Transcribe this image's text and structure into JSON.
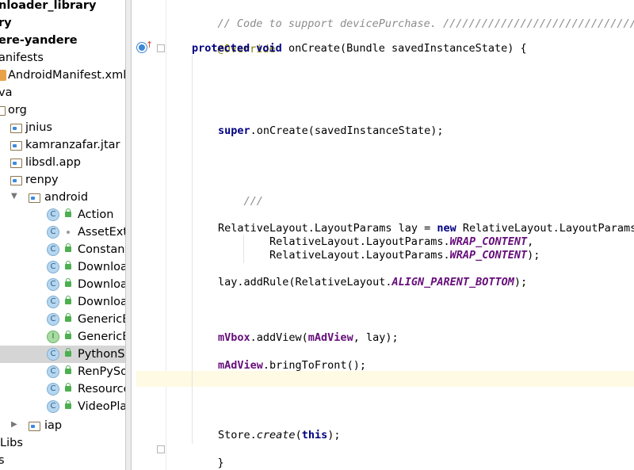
{
  "project_tree": {
    "items": [
      {
        "label": "nloader_library",
        "bold": true
      },
      {
        "label": "ry",
        "bold": true
      },
      {
        "label": "ere-yandere",
        "bold": true
      },
      {
        "label": "anifests",
        "bold": false
      },
      {
        "label": "AndroidManifest.xml",
        "bold": false
      },
      {
        "label": "va",
        "bold": false
      },
      {
        "label": "org",
        "bold": false
      },
      {
        "label": "jnius",
        "bold": false
      },
      {
        "label": "kamranzafar.jtar",
        "bold": false
      },
      {
        "label": "libsdl.app",
        "bold": false
      },
      {
        "label": "renpy",
        "bold": false
      },
      {
        "label": "android",
        "bold": false
      },
      {
        "label": "Action",
        "icon": "C"
      },
      {
        "label": "AssetExt",
        "icon": "C"
      },
      {
        "label": "Constant",
        "icon": "C"
      },
      {
        "label": "Downloa",
        "icon": "C"
      },
      {
        "label": "Downloa",
        "icon": "C"
      },
      {
        "label": "Downloa",
        "icon": "C"
      },
      {
        "label": "GenericB",
        "icon": "C"
      },
      {
        "label": "GenericB",
        "icon": "I"
      },
      {
        "label": "PythonSD",
        "icon": "C"
      },
      {
        "label": "RenPySo",
        "icon": "C"
      },
      {
        "label": "Resource",
        "icon": "C"
      },
      {
        "label": "VideoPla",
        "icon": "C"
      },
      {
        "label": "iap",
        "bold": false
      },
      {
        "label": "iLibs",
        "bold": false
      },
      {
        "label": "s",
        "bold": false
      }
    ]
  },
  "code": {
    "comment_line": "// Code to support devicePurchase. ////////////////////////////////////",
    "annotation": "@Override",
    "kw_protected": "protected",
    "kw_void": "void",
    "method_sig": " onCreate(Bundle savedInstanceState) {",
    "kw_super": "super",
    "super_call": ".onCreate(savedInstanceState);",
    "slash_comment": "///",
    "lay_decl_a": "RelativeLayout.LayoutParams lay = ",
    "kw_new": "new",
    "lay_decl_b": " RelativeLayout.LayoutParams(",
    "wrap_prefix": "RelativeLayout.LayoutParams.",
    "wrap_const": "WRAP_CONTENT",
    "wrap_sep1": ",",
    "wrap_sep2": ");",
    "addrule_a": "lay.addRule(RelativeLayout.",
    "addrule_const": "ALIGN_PARENT_BOTTOM",
    "addrule_b": ");",
    "mvbox": "mVbox",
    "addview_a": ".addView(",
    "madview": "mAdView",
    "addview_b": ", lay);",
    "bring_b": ".bringToFront();",
    "store_a": "Store.",
    "store_create": "create",
    "store_b": "(",
    "kw_this": "this",
    "store_c": ");",
    "close_brace": "}"
  },
  "colors": {
    "keyword": "#000080",
    "field": "#660e7a",
    "annotation": "#808000",
    "comment": "#8c8c8c",
    "selection": "#d5d5d5",
    "caret_line": "#fffae3"
  }
}
